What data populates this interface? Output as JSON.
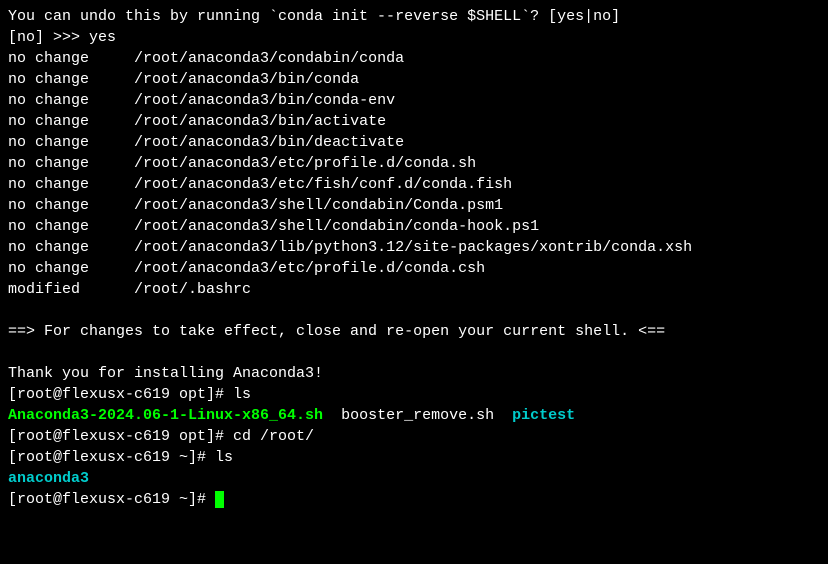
{
  "question": "You can undo this by running `conda init --reverse $SHELL`? [yes|no]",
  "input_line": "[no] >>> yes",
  "changes": [
    {
      "status": "no change",
      "path": "/root/anaconda3/condabin/conda"
    },
    {
      "status": "no change",
      "path": "/root/anaconda3/bin/conda"
    },
    {
      "status": "no change",
      "path": "/root/anaconda3/bin/conda-env"
    },
    {
      "status": "no change",
      "path": "/root/anaconda3/bin/activate"
    },
    {
      "status": "no change",
      "path": "/root/anaconda3/bin/deactivate"
    },
    {
      "status": "no change",
      "path": "/root/anaconda3/etc/profile.d/conda.sh"
    },
    {
      "status": "no change",
      "path": "/root/anaconda3/etc/fish/conf.d/conda.fish"
    },
    {
      "status": "no change",
      "path": "/root/anaconda3/shell/condabin/Conda.psm1"
    },
    {
      "status": "no change",
      "path": "/root/anaconda3/shell/condabin/conda-hook.ps1"
    },
    {
      "status": "no change",
      "path": "/root/anaconda3/lib/python3.12/site-packages/xontrib/conda.xsh"
    },
    {
      "status": "no change",
      "path": "/root/anaconda3/etc/profile.d/conda.csh"
    },
    {
      "status": "modified ",
      "path": "/root/.bashrc"
    }
  ],
  "effect_message": "==> For changes to take effect, close and re-open your current shell. <==",
  "thanks_message": "Thank you for installing Anaconda3!",
  "prompts": {
    "opt_ls": "[root@flexusx-c619 opt]# ls",
    "opt_ls_output": {
      "file1": "Anaconda3-2024.06-1-Linux-x86_64.sh",
      "file2": "booster_remove.sh",
      "file3": "pictest"
    },
    "opt_cd": "[root@flexusx-c619 opt]# cd /root/",
    "root_ls": "[root@flexusx-c619 ~]# ls",
    "root_ls_output": "anaconda3",
    "root_prompt": "[root@flexusx-c619 ~]# "
  }
}
